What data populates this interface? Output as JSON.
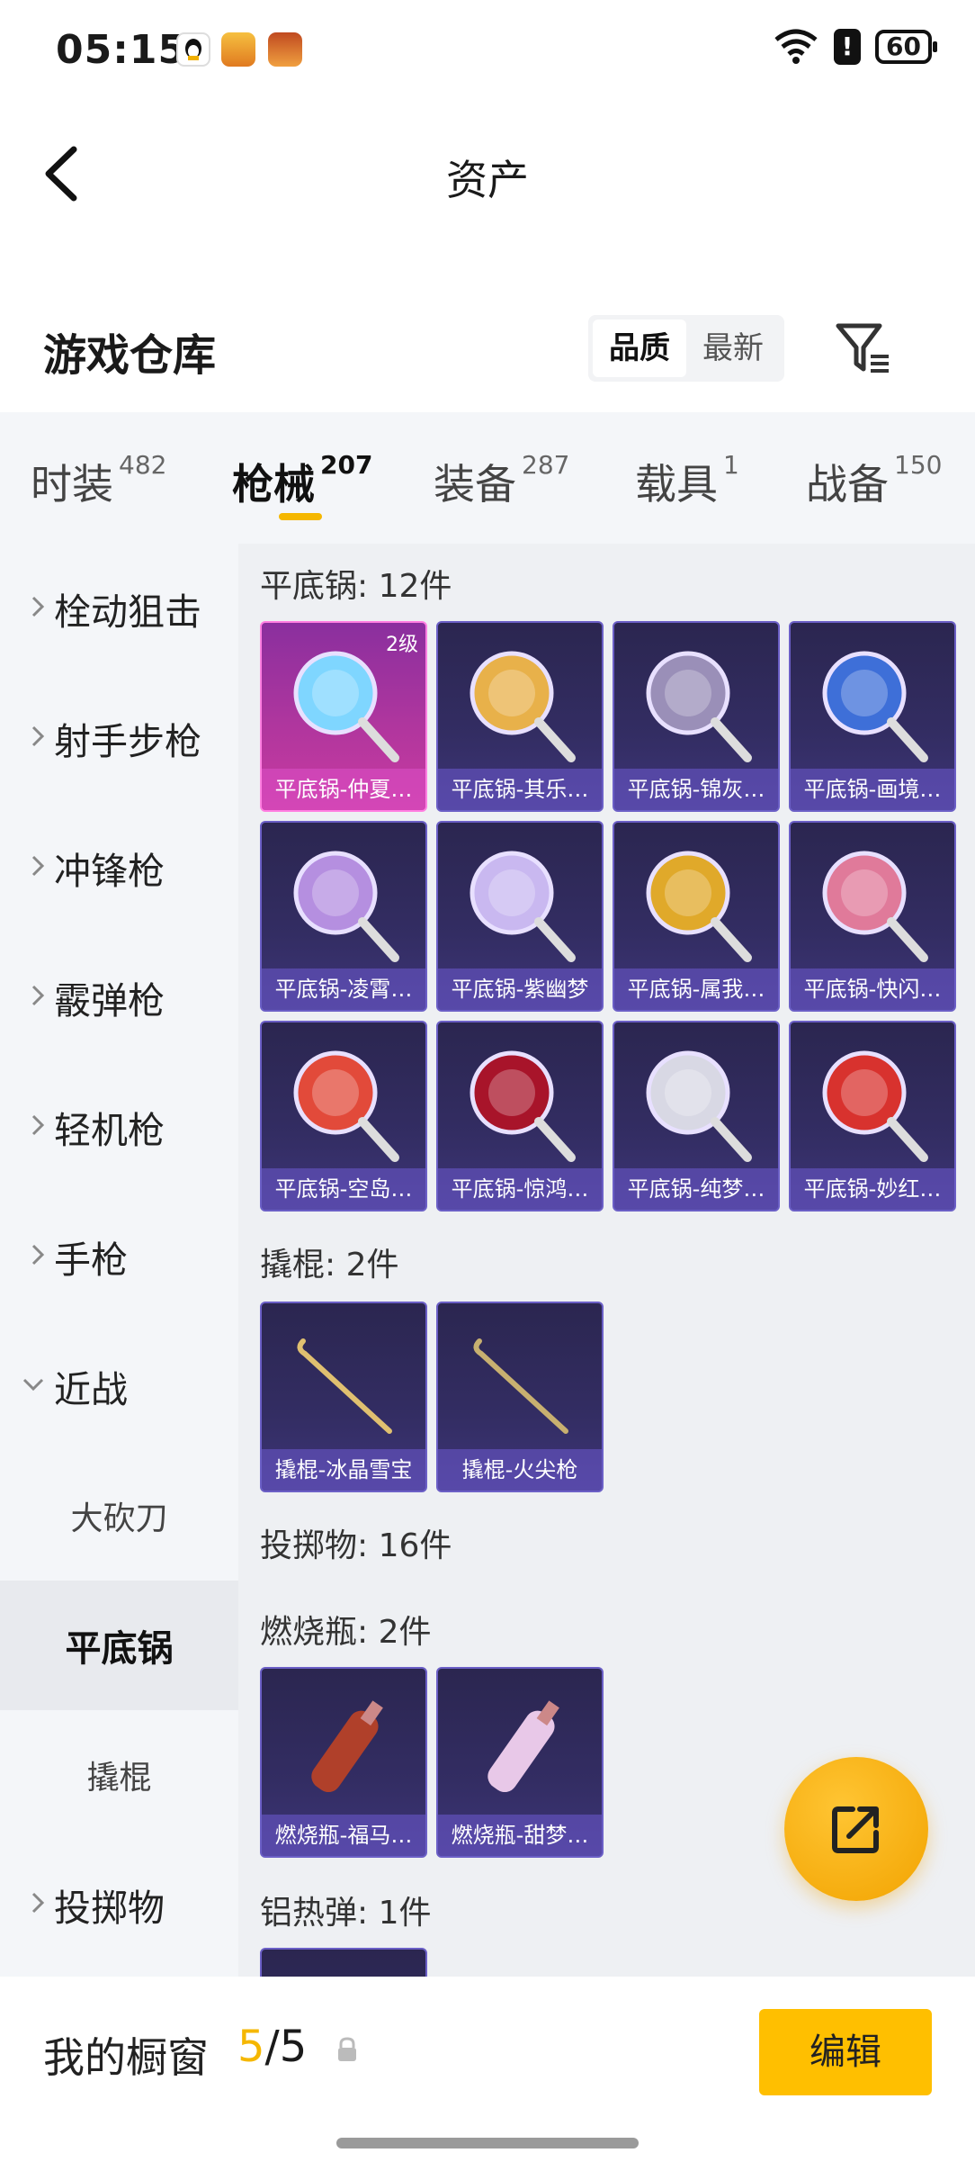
{
  "status_bar": {
    "time": "05:15",
    "battery": "60",
    "alert": "!"
  },
  "header": {
    "title": "资产"
  },
  "warehouse": {
    "title": "游戏仓库",
    "sort_options": [
      "品质",
      "最新"
    ],
    "selected_sort": "品质"
  },
  "tabs": [
    {
      "label": "时装",
      "count": "482"
    },
    {
      "label": "枪械",
      "count": "207"
    },
    {
      "label": "装备",
      "count": "287"
    },
    {
      "label": "载具",
      "count": "1"
    },
    {
      "label": "战备",
      "count": "150"
    }
  ],
  "active_tab": "枪械",
  "sidebar": {
    "items": [
      {
        "label": "栓动狙击"
      },
      {
        "label": "射手步枪"
      },
      {
        "label": "冲锋枪"
      },
      {
        "label": "霰弹枪"
      },
      {
        "label": "轻机枪"
      },
      {
        "label": "手枪"
      },
      {
        "label": "近战"
      }
    ],
    "sub_items": [
      {
        "label": "大砍刀"
      },
      {
        "label": "平底锅"
      },
      {
        "label": "撬棍"
      }
    ],
    "active_sub": "平底锅",
    "after": {
      "label": "投掷物"
    }
  },
  "sections": [
    {
      "title": "平底锅: 12件",
      "items": [
        {
          "name": "平底锅-仲夏…",
          "level": "2级",
          "rare": true,
          "color": "#7fd6ff"
        },
        {
          "name": "平底锅-其乐…",
          "color": "#e8b14a"
        },
        {
          "name": "平底锅-锦灰…",
          "color": "#9a8fb8"
        },
        {
          "name": "平底锅-画境…",
          "color": "#3e6fd8"
        },
        {
          "name": "平底锅-凌霄…",
          "color": "#b58fe0"
        },
        {
          "name": "平底锅-紫幽梦",
          "color": "#c9b8f0"
        },
        {
          "name": "平底锅-属我…",
          "color": "#e0a92a"
        },
        {
          "name": "平底锅-快闪…",
          "color": "#e07a9a"
        },
        {
          "name": "平底锅-空岛…",
          "color": "#e24a3a"
        },
        {
          "name": "平底锅-惊鸿…",
          "color": "#a8142a"
        },
        {
          "name": "平底锅-纯梦…",
          "color": "#d8d8e4"
        },
        {
          "name": "平底锅-妙红…",
          "color": "#d8322e"
        }
      ]
    },
    {
      "title": "撬棍: 2件",
      "items": [
        {
          "name": "撬棍-冰晶雪宝",
          "color": "#e0c070"
        },
        {
          "name": "撬棍-火尖枪",
          "color": "#c8b070"
        }
      ]
    },
    {
      "title": "投掷物: 16件",
      "items": []
    },
    {
      "title": "燃烧瓶: 2件",
      "items": [
        {
          "name": "燃烧瓶-福马…",
          "color": "#b0402a"
        },
        {
          "name": "燃烧瓶-甜梦…",
          "color": "#e8c8e8"
        }
      ]
    },
    {
      "title": "铝热弹: 1件",
      "items": [
        {
          "name": "",
          "color": "#444"
        }
      ]
    }
  ],
  "bottom_bar": {
    "title": "我的橱窗",
    "current": "5",
    "separator": "/",
    "total": "5",
    "edit_label": "编辑"
  }
}
